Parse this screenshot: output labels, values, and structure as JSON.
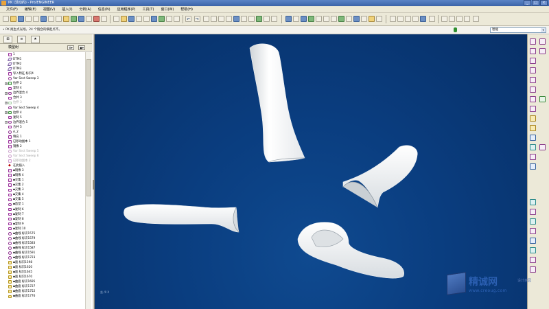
{
  "window": {
    "title": "PK (活动的) - Pro/ENGINEER",
    "buttons": [
      "_",
      "□",
      "×"
    ]
  },
  "menu": [
    "文件(F)",
    "编辑(E)",
    "视图(V)",
    "插入(I)",
    "分析(A)",
    "信息(N)",
    "应用程序(P)",
    "工具(T)",
    "窗口(W)",
    "帮助(H)"
  ],
  "message": "• PK 尾生点光线，24 个随合的横起点不。",
  "filter": {
    "label": "智能",
    "arrow": "▾"
  },
  "panel": {
    "tabs": [
      "⊞",
      "≡",
      "★"
    ],
    "tree_title": "模型树",
    "header_buttons": [
      "⚙▾",
      "▣▾"
    ],
    "items": [
      {
        "label": "1",
        "icon": "part-icon",
        "dim": false
      },
      {
        "label": "DTM1",
        "icon": "datum-plane-icon",
        "dim": false
      },
      {
        "label": "DTM2",
        "icon": "datum-plane-icon",
        "dim": false
      },
      {
        "label": "DTM3",
        "icon": "datum-plane-icon",
        "dim": false
      },
      {
        "label": "导入特征 标识4",
        "icon": "import-feature-icon",
        "dim": false
      },
      {
        "label": "Var Sect Sweep 3",
        "icon": "sweep-icon",
        "dim": false
      },
      {
        "label": "拉伸 2",
        "icon": "extrude-icon",
        "dim": false,
        "expand": "+"
      },
      {
        "label": "复制 4",
        "icon": "copy-icon",
        "dim": false
      },
      {
        "label": "边界混合 4",
        "icon": "boundary-blend-icon",
        "dim": false,
        "expand": "+"
      },
      {
        "label": "合并 3",
        "icon": "merge-icon",
        "dim": false
      },
      {
        "label": "拉伸 3",
        "icon": "extrude-icon",
        "dim": true,
        "expand": "+"
      },
      {
        "label": "Var Sect Sweep 4",
        "icon": "sweep-icon",
        "dim": false
      },
      {
        "label": "拉伸 4",
        "icon": "extrude-icon",
        "dim": false,
        "expand": "+"
      },
      {
        "label": "复制 5",
        "icon": "copy-icon",
        "dim": false
      },
      {
        "label": "边界混合 5",
        "icon": "boundary-blend-icon",
        "dim": false,
        "expand": "+"
      },
      {
        "label": "合并 5",
        "icon": "merge-icon",
        "dim": false
      },
      {
        "label": "A_2",
        "icon": "curve-icon",
        "dim": false
      },
      {
        "label": "填充 1",
        "icon": "fill-icon",
        "dim": false
      },
      {
        "label": "已移动副本 1",
        "icon": "moved-copy-icon",
        "dim": false
      },
      {
        "label": "镜像 2",
        "icon": "mirror-icon",
        "dim": false
      },
      {
        "label": "Var Sect Sweep 5",
        "icon": "sweep-icon",
        "dim": true
      },
      {
        "label": "Var Sect Sweep 6",
        "icon": "sweep-icon",
        "dim": true
      },
      {
        "label": "已移动副本 2",
        "icon": "moved-copy-icon",
        "dim": true
      },
      {
        "label": "在此插入",
        "icon": "insert-here-icon",
        "dim": false
      },
      {
        "label": "▪镜像 3",
        "icon": "mirror-icon",
        "dim": false
      },
      {
        "label": "▪镜像 4",
        "icon": "mirror-icon",
        "dim": false
      },
      {
        "label": "▪交集 1",
        "icon": "intersect-icon",
        "dim": false
      },
      {
        "label": "▪交集 2",
        "icon": "intersect-icon",
        "dim": false
      },
      {
        "label": "▪交集 3",
        "icon": "intersect-icon",
        "dim": false
      },
      {
        "label": "▪交集 4",
        "icon": "intersect-icon",
        "dim": false
      },
      {
        "label": "▪交集 5",
        "icon": "intersect-icon",
        "dim": false
      },
      {
        "label": "▪造型 1",
        "icon": "style-icon",
        "dim": false
      },
      {
        "label": "▪复制 6",
        "icon": "copy-icon",
        "dim": false
      },
      {
        "label": "▪复制 7",
        "icon": "copy-icon",
        "dim": false
      },
      {
        "label": "▪复制 8",
        "icon": "copy-icon",
        "dim": false
      },
      {
        "label": "▪复制 9",
        "icon": "copy-icon",
        "dim": false
      },
      {
        "label": "▪复制 10",
        "icon": "copy-icon",
        "dim": false
      },
      {
        "label": "▪曲线 标识1575",
        "icon": "curve-icon",
        "dim": false
      },
      {
        "label": "▪曲线 标识1579",
        "icon": "curve-icon",
        "dim": false
      },
      {
        "label": "▪曲线 标识1583",
        "icon": "curve-icon",
        "dim": false
      },
      {
        "label": "▪曲线 标识1587",
        "icon": "curve-icon",
        "dim": false
      },
      {
        "label": "▪曲线 标识1591",
        "icon": "curve-icon",
        "dim": false
      },
      {
        "label": "▪曲线 标识1723",
        "icon": "curve-icon",
        "dim": false
      },
      {
        "label": "▪面 标识1598",
        "icon": "surface-icon",
        "dim": false
      },
      {
        "label": "▪面 标识1620",
        "icon": "surface-icon",
        "dim": false
      },
      {
        "label": "▪面 标识1645",
        "icon": "surface-icon",
        "dim": false
      },
      {
        "label": "▪面 标识1670",
        "icon": "surface-icon",
        "dim": false
      },
      {
        "label": "▪曲面 标识1695",
        "icon": "surface-icon",
        "dim": false
      },
      {
        "label": "▪曲面 标识1727",
        "icon": "surface-icon",
        "dim": false
      },
      {
        "label": "▪曲面 标识1752",
        "icon": "surface-icon",
        "dim": false
      },
      {
        "label": "▪曲面 标识1776",
        "icon": "surface-icon",
        "dim": false
      }
    ]
  },
  "viewport": {
    "coord_text": "坐 /0 X"
  },
  "watermark": {
    "name": "精诚网",
    "tagline": "设计家园",
    "url": "www.creoug.com"
  },
  "colors": {
    "viewport_bg": "#0a3d7f",
    "surface": "#f7f7f7",
    "title_bar": "#3a63a8",
    "window_bg": "#ece9d8"
  }
}
